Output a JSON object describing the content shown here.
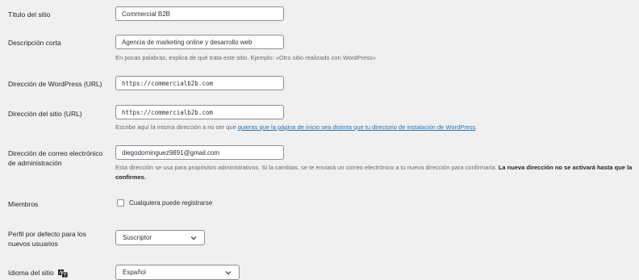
{
  "site_title": {
    "label": "Título del sitio",
    "value": "Commercial B2B"
  },
  "tagline": {
    "label": "Descripción corta",
    "value": "Agencia de marketing online y desarrollo web",
    "description": "En pocas palabras, explica de qué trata este sitio. Ejemplo: «Otro sitio realizado con WordPress»"
  },
  "wp_address": {
    "label": "Dirección de WordPress (URL)",
    "value": "https://commercialb2b.com"
  },
  "site_address": {
    "label": "Dirección del sitio (URL)",
    "value": "https://commercialb2b.com",
    "description_pre": "Escribe aquí la misma dirección a no ser que ",
    "description_link": "quieras que la página de inicio sea distinta que tu directorio de instalación de WordPress",
    "description_post": "."
  },
  "admin_email": {
    "label": "Dirección de correo electrónico de administración",
    "value": "diegodominguez9891@gmail.com",
    "description": "Esta dirección se usa para propósitos administrativos. Si la cambias, se te enviará un correo electrónico a tu nueva dirección para confirmarla.",
    "description_bold": "La nueva dirección no se activará hasta que la confirmes."
  },
  "membership": {
    "label": "Miembros",
    "checkbox_label": "Cualquiera puede registrarse",
    "checked": false
  },
  "default_role": {
    "label": "Perfil por defecto para los nuevos usuarios",
    "selected": "Suscriptor"
  },
  "site_language": {
    "label": "Idioma del sitio",
    "icon": "translation-icon",
    "selected": "Español"
  }
}
